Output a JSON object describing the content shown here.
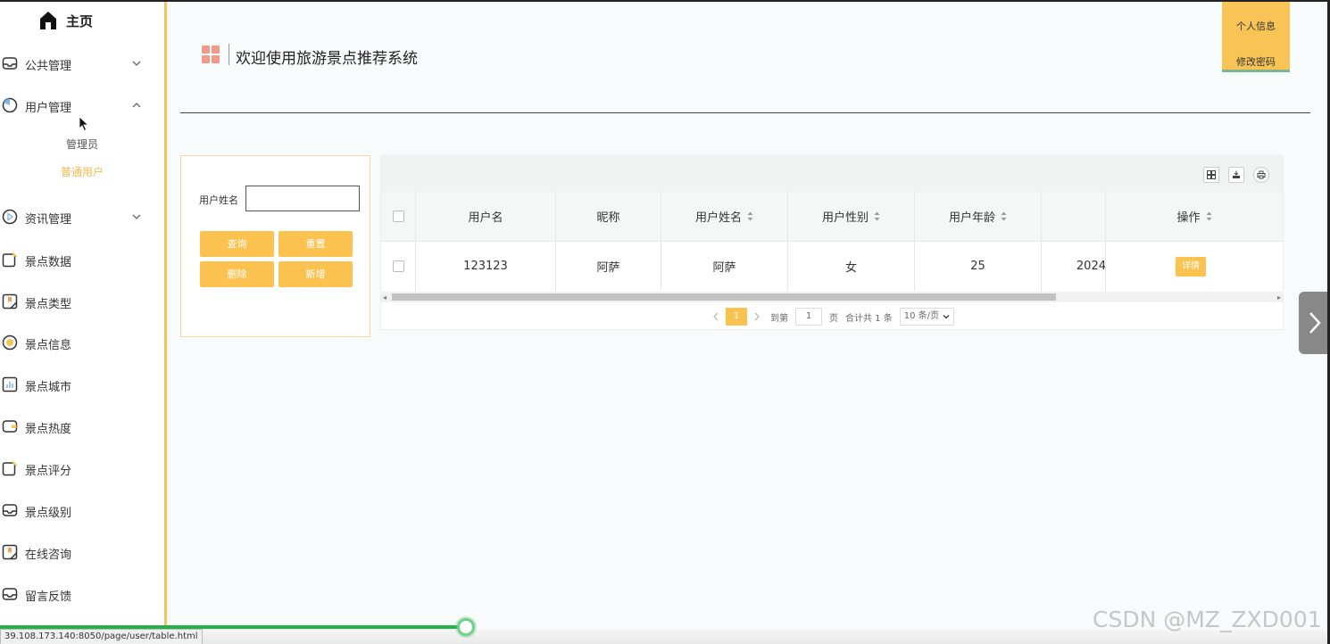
{
  "sidebar": {
    "home_label": "主页",
    "items": [
      {
        "label": "公共管理",
        "icon": "inbox-icon",
        "chevron": "down"
      },
      {
        "label": "用户管理",
        "icon": "pie-chart-icon",
        "chevron": "up"
      },
      {
        "label": "资讯管理",
        "icon": "play-circle-icon",
        "chevron": "down"
      },
      {
        "label": "景点数据",
        "icon": "edit-note-icon"
      },
      {
        "label": "景点类型",
        "icon": "bookmark-icon"
      },
      {
        "label": "景点信息",
        "icon": "yen-circle-icon"
      },
      {
        "label": "景点城市",
        "icon": "bar-chart-icon"
      },
      {
        "label": "景点热度",
        "icon": "wallet-icon"
      },
      {
        "label": "景点评分",
        "icon": "edit-note-icon"
      },
      {
        "label": "景点级别",
        "icon": "inbox-icon"
      },
      {
        "label": "在线咨询",
        "icon": "bookmark-icon"
      },
      {
        "label": "留言反馈",
        "icon": "inbox-icon"
      }
    ],
    "submenu": [
      {
        "label": "管理员",
        "active": false
      },
      {
        "label": "普通用户",
        "active": true
      }
    ]
  },
  "header": {
    "title": "欢迎使用旅游景点推荐系统",
    "user_menu": {
      "info": "个人信息",
      "password": "修改密码"
    }
  },
  "search": {
    "label": "用户姓名",
    "value": "",
    "buttons": {
      "query": "查询",
      "reset": "重置",
      "delete": "删除",
      "add": "新增"
    }
  },
  "table": {
    "columns": [
      "用户名",
      "昵称",
      "用户姓名",
      "用户性别",
      "用户年龄",
      "",
      "操作"
    ],
    "rows": [
      {
        "username": "123123",
        "nickname": "阿萨",
        "name": "阿萨",
        "gender": "女",
        "age": "25",
        "date_partial": "2024",
        "action": "详情"
      }
    ]
  },
  "pagination": {
    "current_page": "1",
    "goto_label": "到第",
    "goto_value": "1",
    "page_unit": "页",
    "total_text": "合计共 1 条",
    "page_size": "10 条/页"
  },
  "status_url": "39.108.173.140:8050/page/user/table.html",
  "progress": 0.35,
  "watermark": "CSDN @MZ_ZXD001",
  "colors": {
    "accent": "#fcc24f",
    "sidebar_border": "#f7c356",
    "active_sub": "#f5b84a",
    "progress": "#22b04b"
  }
}
